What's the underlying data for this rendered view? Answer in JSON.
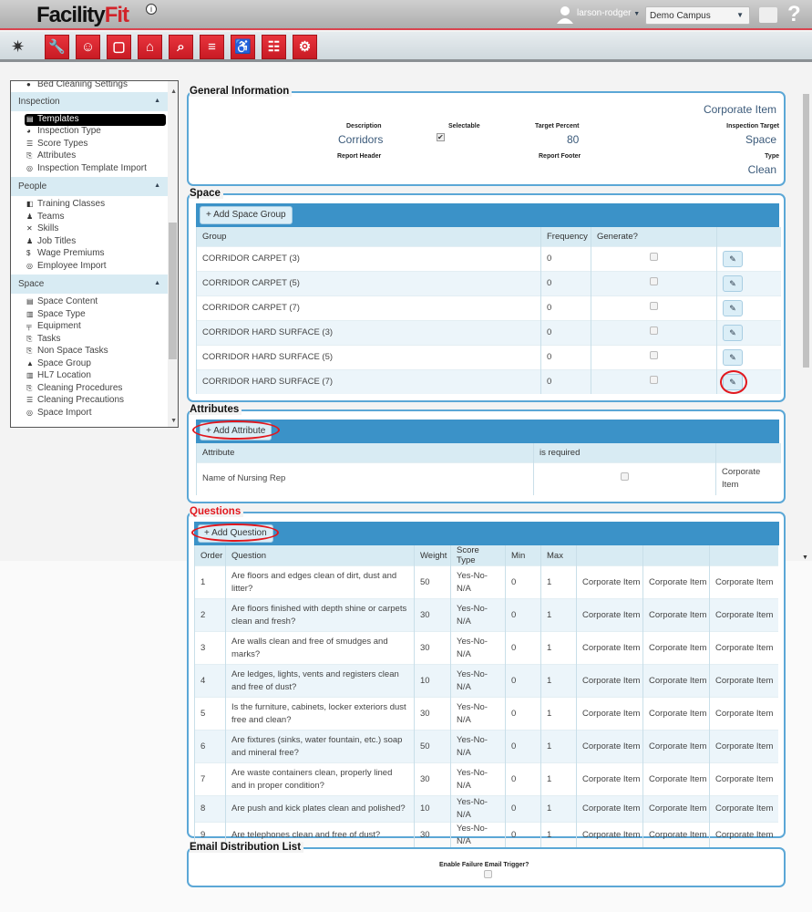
{
  "header": {
    "logo": "FacilityFit",
    "username": "larson-rodger",
    "campus": "Demo Campus",
    "help": "?"
  },
  "toolbar": {
    "icons": [
      "wrench-icon",
      "person-icon",
      "monitor-icon",
      "house-icon",
      "search-icon",
      "bed-icon",
      "wheelchair-icon",
      "document-icon",
      "gears-icon"
    ],
    "glyphs": [
      "🔧",
      "☺",
      "▢",
      "⌂",
      "⌕",
      "≡",
      "♿",
      "☷",
      "⚙"
    ]
  },
  "sidebar": {
    "top_item": "Bed Cleaning Settings",
    "sections": [
      {
        "title": "Inspection",
        "items": [
          "Templates",
          "Inspection Type",
          "Score Types",
          "Attributes",
          "Inspection Template Import"
        ],
        "active": 0
      },
      {
        "title": "People",
        "items": [
          "Training Classes",
          "Teams",
          "Skills",
          "Job Titles",
          "Wage Premiums",
          "Employee Import"
        ]
      },
      {
        "title": "Space",
        "items": [
          "Space Content",
          "Space Type",
          "Equipment",
          "Tasks",
          "Non Space Tasks",
          "Space Group",
          "HL7 Location",
          "Cleaning Procedures",
          "Cleaning Precautions",
          "Space Import"
        ]
      }
    ]
  },
  "general": {
    "legend": "General Information",
    "corporate": "Corporate Item",
    "description_label": "Description",
    "description": "Corridors",
    "selectable_label": "Selectable",
    "selectable": true,
    "target_percent_label": "Target Percent",
    "target_percent": "80",
    "inspection_target_label": "Inspection Target",
    "inspection_target": "Space",
    "report_header_label": "Report Header",
    "report_footer_label": "Report Footer",
    "type_label": "Type",
    "type": "Clean"
  },
  "space": {
    "legend": "Space",
    "add_label": "Add Space Group",
    "columns": [
      "Group",
      "Frequency",
      "Generate?",
      ""
    ],
    "rows": [
      [
        "CORRIDOR CARPET (3)",
        "0"
      ],
      [
        "CORRIDOR CARPET (5)",
        "0"
      ],
      [
        "CORRIDOR CARPET (7)",
        "0"
      ],
      [
        "CORRIDOR HARD SURFACE (3)",
        "0"
      ],
      [
        "CORRIDOR HARD SURFACE (5)",
        "0"
      ],
      [
        "CORRIDOR HARD SURFACE (7)",
        "0"
      ]
    ]
  },
  "attributes": {
    "legend": "Attributes",
    "add_label": "Add Attribute",
    "columns": [
      "Attribute",
      "is required",
      ""
    ],
    "rows": [
      [
        "Name of Nursing Rep",
        "Corporate Item"
      ]
    ]
  },
  "questions": {
    "legend": "Questions",
    "add_label": "Add Question",
    "columns": [
      "Order",
      "Question",
      "Weight",
      "Score Type",
      "Min",
      "Max",
      "",
      "",
      ""
    ],
    "rows": [
      [
        "1",
        "Are floors and edges clean of dirt, dust and litter?",
        "50",
        "Yes-No-N/A",
        "0",
        "1",
        "Corporate Item",
        "Corporate Item",
        "Corporate Item"
      ],
      [
        "2",
        "Are floors finished with depth shine or carpets clean and fresh?",
        "30",
        "Yes-No-N/A",
        "0",
        "1",
        "Corporate Item",
        "Corporate Item",
        "Corporate Item"
      ],
      [
        "3",
        "Are walls clean and free of smudges and marks?",
        "30",
        "Yes-No-N/A",
        "0",
        "1",
        "Corporate Item",
        "Corporate Item",
        "Corporate Item"
      ],
      [
        "4",
        "Are ledges, lights, vents and registers clean and free of dust?",
        "10",
        "Yes-No-N/A",
        "0",
        "1",
        "Corporate Item",
        "Corporate Item",
        "Corporate Item"
      ],
      [
        "5",
        "Is the furniture, cabinets, locker exteriors dust free and clean?",
        "30",
        "Yes-No-N/A",
        "0",
        "1",
        "Corporate Item",
        "Corporate Item",
        "Corporate Item"
      ],
      [
        "6",
        "Are fixtures (sinks, water fountain, etc.) soap and mineral free?",
        "50",
        "Yes-No-N/A",
        "0",
        "1",
        "Corporate Item",
        "Corporate Item",
        "Corporate Item"
      ],
      [
        "7",
        "Are waste containers clean, properly lined and in proper condition?",
        "30",
        "Yes-No-N/A",
        "0",
        "1",
        "Corporate Item",
        "Corporate Item",
        "Corporate Item"
      ],
      [
        "8",
        "Are push and kick plates clean and polished?",
        "10",
        "Yes-No-N/A",
        "0",
        "1",
        "Corporate Item",
        "Corporate Item",
        "Corporate Item"
      ],
      [
        "9",
        "Are telephones clean and free of dust?",
        "30",
        "Yes-No-N/A",
        "0",
        "1",
        "Corporate Item",
        "Corporate Item",
        "Corporate Item"
      ]
    ]
  },
  "email": {
    "legend": "Email Distribution List",
    "trigger_label": "Enable Failure Email Trigger?",
    "trigger": false
  },
  "colors": {
    "brand_red": "#d2232a",
    "panel_border": "#5ba7d6",
    "bar_blue": "#3b92c8",
    "highlight_ring": "#e2171d"
  }
}
